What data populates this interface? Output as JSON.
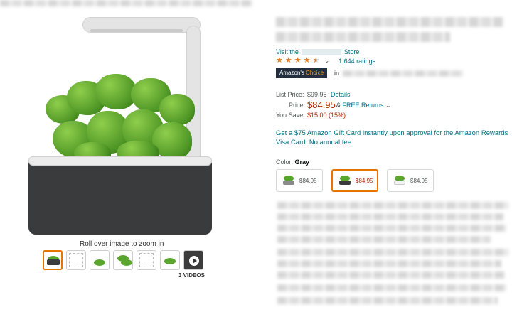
{
  "gallery": {
    "zoom_hint": "Roll over image to zoom in",
    "videos_label": "3 VIDEOS",
    "thumbnail_count": 7
  },
  "store": {
    "prefix": "Visit the",
    "suffix": "Store"
  },
  "rating": {
    "stars": 4.5,
    "ratings_count": "1,644 ratings"
  },
  "badge": {
    "prefix": "Amazon's",
    "highlight": "Choice",
    "in_text": "in"
  },
  "pricing": {
    "list_price_label": "List Price:",
    "list_price": "$99.95",
    "details_link": "Details",
    "price_label": "Price:",
    "price": "$84.95",
    "free_returns_amp": "&",
    "free_returns": "FREE Returns",
    "save_label": "You Save:",
    "save_amount": "$15.00 (15%)"
  },
  "promo": {
    "gift_card": "Get a $75 Amazon Gift Card instantly upon approval for the Amazon Rewards Visa Card. No annual fee."
  },
  "variants": {
    "color_label": "Color:",
    "color_value": "Gray",
    "options": [
      {
        "price": "$84.95",
        "pot_color": "#8a8a8a",
        "selected": false
      },
      {
        "price": "$84.95",
        "pot_color": "#3a3b3d",
        "selected": true
      },
      {
        "price": "$84.95",
        "pot_color": "#f2f2f2",
        "selected": false
      }
    ]
  },
  "colors": {
    "price_red": "#b12704",
    "link_teal": "#007185",
    "star_orange": "#de7921",
    "selected_orange": "#e77600"
  }
}
